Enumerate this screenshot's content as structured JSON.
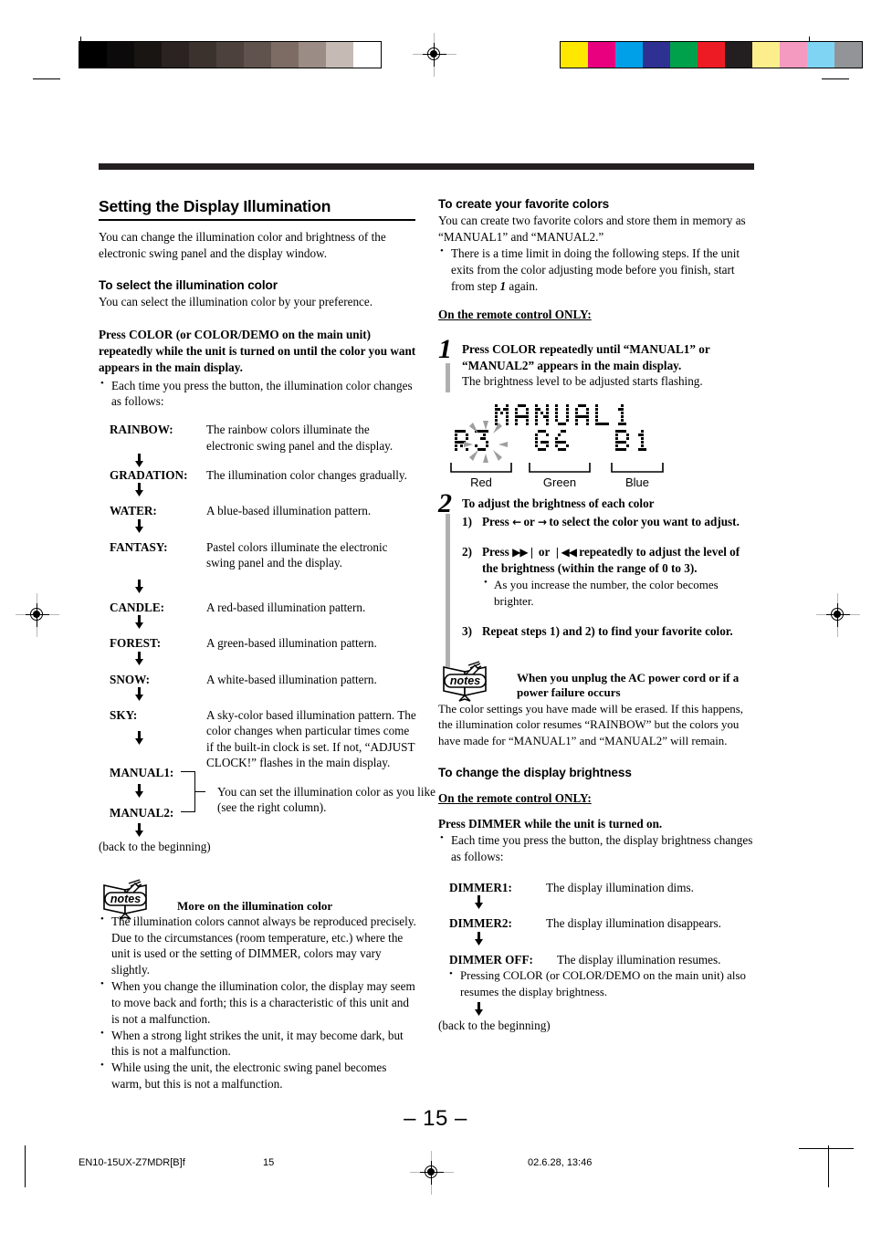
{
  "page": {
    "number_display": "– 15 –",
    "header_rule": true
  },
  "registration": {
    "gray_bar_swatches": [
      "#000000",
      "#0c0a0a",
      "#191513",
      "#2a2321",
      "#3b322e",
      "#4c413c",
      "#60524c",
      "#7c6c64",
      "#9b8d85",
      "#c6bbb4",
      "#ffffff"
    ],
    "color_bar_swatches": [
      "#ffe800",
      "#e8007f",
      "#00a0e9",
      "#2e3192",
      "#00a14b",
      "#ed1c24",
      "#231f20",
      "#fdee8c",
      "#f49ac1",
      "#7fd4f4",
      "#929497"
    ]
  },
  "left_column": {
    "section_title": "Setting the Display Illumination",
    "intro": "You can change the illumination color and brightness of the electronic swing panel and the display window.",
    "subsection_title": "To select the illumination color",
    "subsection_intro": "You can select the illumination color by your preference.",
    "instruction_bold": "Press COLOR (or COLOR/DEMO on the main unit) repeatedly while the unit is turned on until the color you want appears in the main display.",
    "instruction_bullet": "Each time you press the button, the illumination color changes as follows:",
    "color_sequence": [
      {
        "name": "RAINBOW:",
        "desc": "The rainbow colors illuminate the electronic swing panel and the display."
      },
      {
        "name": "GRADATION:",
        "desc": "The illumination color changes gradually."
      },
      {
        "name": "WATER:",
        "desc": "A blue-based illumination pattern."
      },
      {
        "name": "FANTASY:",
        "desc": "Pastel colors illuminate the electronic swing panel and the display."
      },
      {
        "name": "CANDLE:",
        "desc": "A red-based illumination pattern."
      },
      {
        "name": "FOREST:",
        "desc": "A green-based illumination pattern."
      },
      {
        "name": "SNOW:",
        "desc": "A white-based illumination pattern."
      },
      {
        "name": "SKY:",
        "desc": "A sky-color based illumination pattern. The color changes when particular times come if the built-in clock is set. If not, “ADJUST CLOCK!” flashes in the main display."
      }
    ],
    "manual1_name": "MANUAL1:",
    "manual2_name": "MANUAL2:",
    "manual_desc": "You can set the illumination color as you like (see the right column).",
    "back_to_beginning": "(back to the beginning)",
    "notes": {
      "icon_label": "notes",
      "heading": "More on the illumination color",
      "items": [
        "The illumination colors cannot always be reproduced precisely. Due to the circumstances (room temperature, etc.) where the unit is used or the setting of DIMMER, colors may vary slightly.",
        "When you change the illumination color, the display may seem to move back and forth; this is a characteristic of this unit and is not a malfunction.",
        "When a strong light strikes the unit, it may become dark, but this is not a malfunction.",
        "While using the unit, the electronic swing panel becomes warm, but this is not a malfunction."
      ]
    }
  },
  "right_column": {
    "subsection_title": "To create your favorite colors",
    "intro": "You can create two favorite colors and store them in memory as “MANUAL1” and “MANUAL2.”",
    "intro_bullet_part1": "There is a time limit in doing the following steps. If the unit exits from the color adjusting mode before you finish, start from step ",
    "intro_bullet_step_num": "1",
    "intro_bullet_part2": " again.",
    "remote_only_1": "On the remote control ONLY:",
    "step1": {
      "number": "1",
      "bold": "Press COLOR repeatedly until “MANUAL1” or “MANUAL2” appears in the main display.",
      "plain": "The brightness level to be adjusted starts flashing."
    },
    "lcd": {
      "line1": "MANUAL1",
      "red_value": "R3",
      "green_value": "G6",
      "blue_value": "B1",
      "label_red": "Red",
      "label_green": "Green",
      "label_blue": "Blue"
    },
    "step2": {
      "number": "2",
      "title": "To adjust the brightness of each color",
      "sub1_label": "1)",
      "sub1_pre": "Press ",
      "sub1_glyph_a": "←",
      "sub1_mid": " or ",
      "sub1_glyph_b": "→",
      "sub1_post": " to select the color you want to adjust.",
      "sub2_label": "2)",
      "sub2_pre": "Press ",
      "sub2_glyph_a": "▶▶❘",
      "sub2_mid": " or ",
      "sub2_glyph_b": "❘◀◀",
      "sub2_post": " repeatedly to adjust the level of the brightness (within the range of 0 to 3).",
      "sub2_bullet": "As you increase the number, the color becomes brighter.",
      "sub3_label": "3)",
      "sub3_text": "Repeat steps 1) and 2) to find your favorite color."
    },
    "notes": {
      "icon_label": "notes",
      "heading": "When you unplug the AC power cord or if a power failure occurs",
      "body": "The color settings you have made will be erased. If this happens, the illumination color resumes “RAINBOW” but the colors you have made for “MANUAL1” and “MANUAL2” will remain."
    },
    "brightness_section_title": "To change the display brightness",
    "remote_only_2": "On the remote control ONLY:",
    "dimmer_instruction": "Press DIMMER while the unit is turned on.",
    "dimmer_bullet": "Each time you press the button, the display brightness changes as follows:",
    "dimmer_sequence": [
      {
        "name": "DIMMER1:",
        "desc": "The display illumination dims."
      },
      {
        "name": "DIMMER2:",
        "desc": "The display illumination disappears."
      },
      {
        "name": "DIMMER OFF:",
        "desc": "The display illumination resumes."
      }
    ],
    "dimmer_extra_bullet": "Pressing COLOR (or COLOR/DEMO on the main unit) also resumes the display brightness.",
    "back_to_beginning": "(back to the beginning)"
  },
  "footer": {
    "file_id": "EN10-15UX-Z7MDR[B]f",
    "page": "15",
    "timestamp": "02.6.28, 13:46"
  }
}
